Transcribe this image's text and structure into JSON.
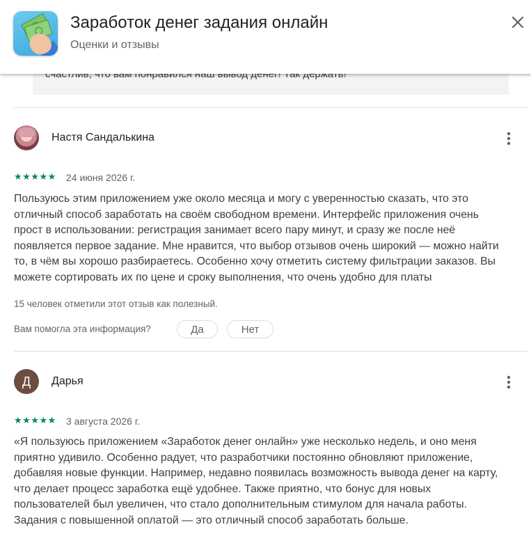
{
  "header": {
    "title": "Заработок денег задания онлайн",
    "subtitle": "Оценки и отзывы",
    "icon": "app-icon",
    "close_icon": "close-icon"
  },
  "developer_reply": {
    "text": "счастлив, что вам понравился наш вывод денег! Так держать!"
  },
  "reviews": [
    {
      "avatar": "avatar-photo",
      "name": "Настя Сандалькина",
      "stars": "★★★★★",
      "rating": 5,
      "date": "24 июня 2026 г.",
      "lines": [
        "Пользуюсь этим приложением уже около месяца и могу с уверенностью сказать, что это",
        "отличный способ заработать на своём свободном времени. Интерфейс приложения очень",
        "прост в использовании: регистрация занимает всего пару минут, и сразу же после неё",
        "появляется первое задание. Мне нравится, что выбор отзывов очень широкий — можно найти",
        "то, в чём вы хорошо разбираетесь. Особенно хочу отметить систему фильтрации заказов. Вы",
        "можете сортировать их по цене и сроку выполнения, что очень удобно для платы"
      ],
      "helpful_count": "15 человек отметили этот отзыв как полезный.",
      "helpful_question": "Вам помогла эта информация?",
      "yes_label": "Да",
      "no_label": "Нет"
    },
    {
      "avatar_letter": "Д",
      "name": "Дарья",
      "stars": "★★★★★",
      "rating": 5,
      "date": "3 августа 2026 г.",
      "lines": [
        "«Я пользуюсь приложением «Заработок денег онлайн» уже несколько недель, и оно меня",
        "приятно удивило. Особенно радует, что разработчики постоянно обновляют приложение,",
        "добавляя новые функции. Например, недавно появилась возможность вывода денег на карту,",
        "что делает процесс заработка ещё удобнее. Также приятно, что бонус для новых",
        "пользователей был увеличен, что стало дополнительным стимулом для начала работы.",
        "Задания с повышенной оплатой — это отличный способ заработать больше."
      ]
    }
  ],
  "colors": {
    "star_green": "#01875f",
    "text_primary": "#202124",
    "text_secondary": "#5f6368",
    "reply_background": "#f1f3f4",
    "avatar_letter_bg": "#6d4c41"
  }
}
